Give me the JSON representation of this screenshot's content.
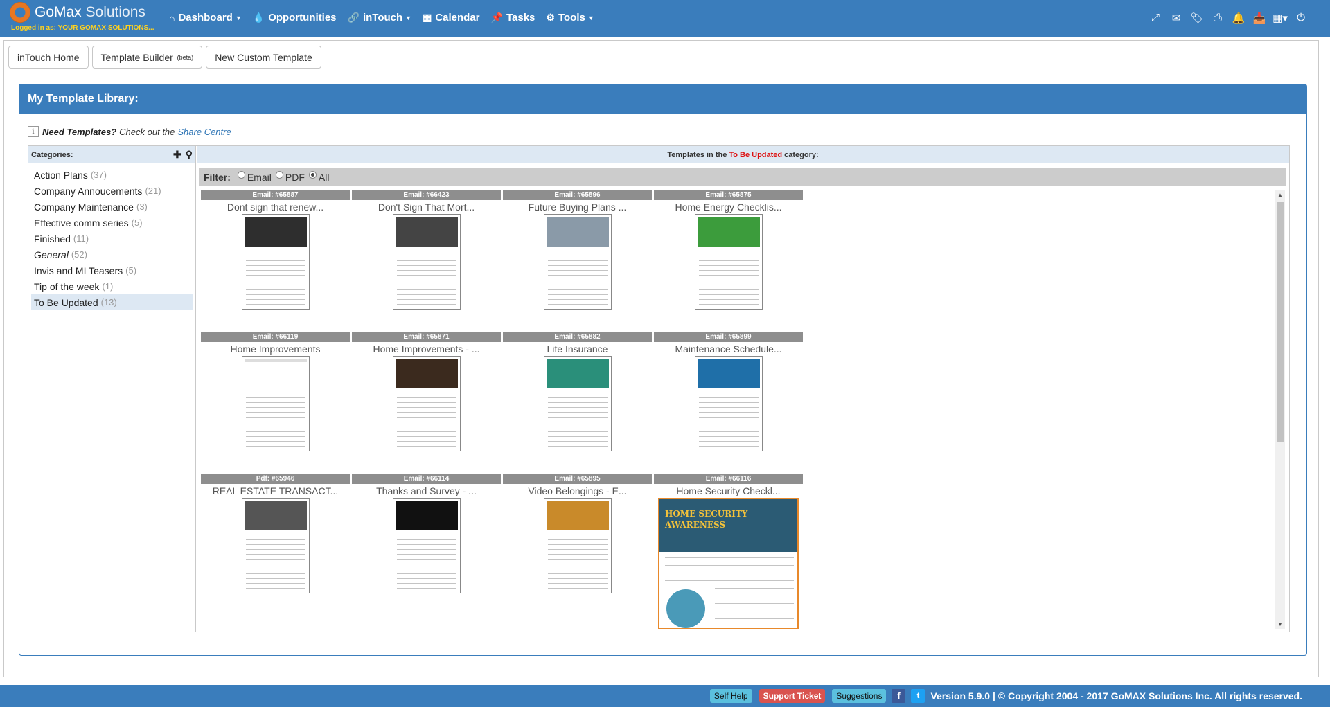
{
  "brand": {
    "name_bold": "GoMax",
    "name_light": "Solutions",
    "logged_label": "Logged in as:",
    "logged_user": "YOUR GOMAX SOLUTIONS..."
  },
  "nav": [
    {
      "label": "Dashboard",
      "icon": "home-icon",
      "glyph": "⌂",
      "caret": true
    },
    {
      "label": "Opportunities",
      "icon": "drop-icon",
      "glyph": "💧",
      "caret": false
    },
    {
      "label": "inTouch",
      "icon": "link-icon",
      "glyph": "🔗",
      "caret": true
    },
    {
      "label": "Calendar",
      "icon": "calendar-icon",
      "glyph": "▦",
      "caret": false
    },
    {
      "label": "Tasks",
      "icon": "pin-icon",
      "glyph": "📌",
      "caret": false
    },
    {
      "label": "Tools",
      "icon": "gear-icon",
      "glyph": "⚙",
      "caret": true
    }
  ],
  "right_icons": [
    {
      "name": "fullscreen-icon",
      "glyph": "⤢"
    },
    {
      "name": "envelope-icon",
      "glyph": "✉"
    },
    {
      "name": "tags-icon",
      "glyph": "🏷"
    },
    {
      "name": "print-icon",
      "glyph": "⎙"
    },
    {
      "name": "bell-icon",
      "glyph": "🔔"
    },
    {
      "name": "inbox-icon",
      "glyph": "📥"
    },
    {
      "name": "calculator-icon",
      "glyph": "▦▾"
    },
    {
      "name": "power-icon",
      "glyph": "⏻"
    }
  ],
  "toolbar": {
    "intouch_home": "inTouch Home",
    "template_builder": "Template Builder",
    "beta": "(beta)",
    "new_custom": "New Custom Template"
  },
  "panel": {
    "title": "My Template Library:",
    "need_bold": "Need Templates?",
    "need_text": "Check out the",
    "share_link": "Share Centre"
  },
  "categories": {
    "header": "Categories:",
    "items": [
      {
        "name": "Action Plans",
        "count": "(37)",
        "active": false,
        "italic": false
      },
      {
        "name": "Company Annoucements",
        "count": "(21)",
        "active": false,
        "italic": false
      },
      {
        "name": "Company Maintenance",
        "count": "(3)",
        "active": false,
        "italic": false
      },
      {
        "name": "Effective comm series",
        "count": "(5)",
        "active": false,
        "italic": false
      },
      {
        "name": "Finished",
        "count": "(11)",
        "active": false,
        "italic": false
      },
      {
        "name": "General",
        "count": "(52)",
        "active": false,
        "italic": true
      },
      {
        "name": "Invis and MI Teasers",
        "count": "(5)",
        "active": false,
        "italic": false
      },
      {
        "name": "Tip of the week",
        "count": "(1)",
        "active": false,
        "italic": false
      },
      {
        "name": "To Be Updated",
        "count": "(13)",
        "active": true,
        "italic": false
      }
    ]
  },
  "main": {
    "head_pre": "Templates in the",
    "head_cat": "To Be Updated",
    "head_post": "category:"
  },
  "filter": {
    "label": "Filter:",
    "options": [
      "Email",
      "PDF",
      "All"
    ],
    "selected": "All"
  },
  "templates": [
    {
      "id": "Email: #65887",
      "title": "Dont sign that renew...",
      "accent": "#2e2e2e"
    },
    {
      "id": "Email: #66423",
      "title": "Don't Sign That Mort...",
      "accent": "#444"
    },
    {
      "id": "Email: #65896",
      "title": "Future Buying Plans ...",
      "accent": "#8a9aa8"
    },
    {
      "id": "Email: #65875",
      "title": "Home Energy Checklis...",
      "accent": "#3c9c3c"
    },
    {
      "id": "Email: #66119",
      "title": "Home Improvements",
      "accent": "#dddddd"
    },
    {
      "id": "Email: #65871",
      "title": "Home Improvements - ...",
      "accent": "#3b2a1e"
    },
    {
      "id": "Email: #65882",
      "title": "Life Insurance",
      "accent": "#2a8f7a"
    },
    {
      "id": "Email: #65899",
      "title": "Maintenance Schedule...",
      "accent": "#1f6fa8"
    },
    {
      "id": "Pdf: #65946",
      "title": "REAL ESTATE TRANSACT...",
      "accent": "#555"
    },
    {
      "id": "Email: #66114",
      "title": "Thanks and Survey - ...",
      "accent": "#111"
    },
    {
      "id": "Email: #65895",
      "title": "Video Belongings - E...",
      "accent": "#c98a2a"
    },
    {
      "id": "Email: #66116",
      "title": "Home Security Checkl...",
      "accent": "#2b5b74"
    }
  ],
  "security_thumb": {
    "heading1": "HOME SECURITY",
    "heading2": "AWARENESS"
  },
  "footer": {
    "self_help": "Self Help",
    "support": "Support Ticket",
    "suggestions": "Suggestions",
    "fb": "f",
    "tw": "t",
    "version": "Version 5.9.0 | © Copyright 2004 - 2017 GoMAX Solutions Inc. All rights reserved."
  }
}
